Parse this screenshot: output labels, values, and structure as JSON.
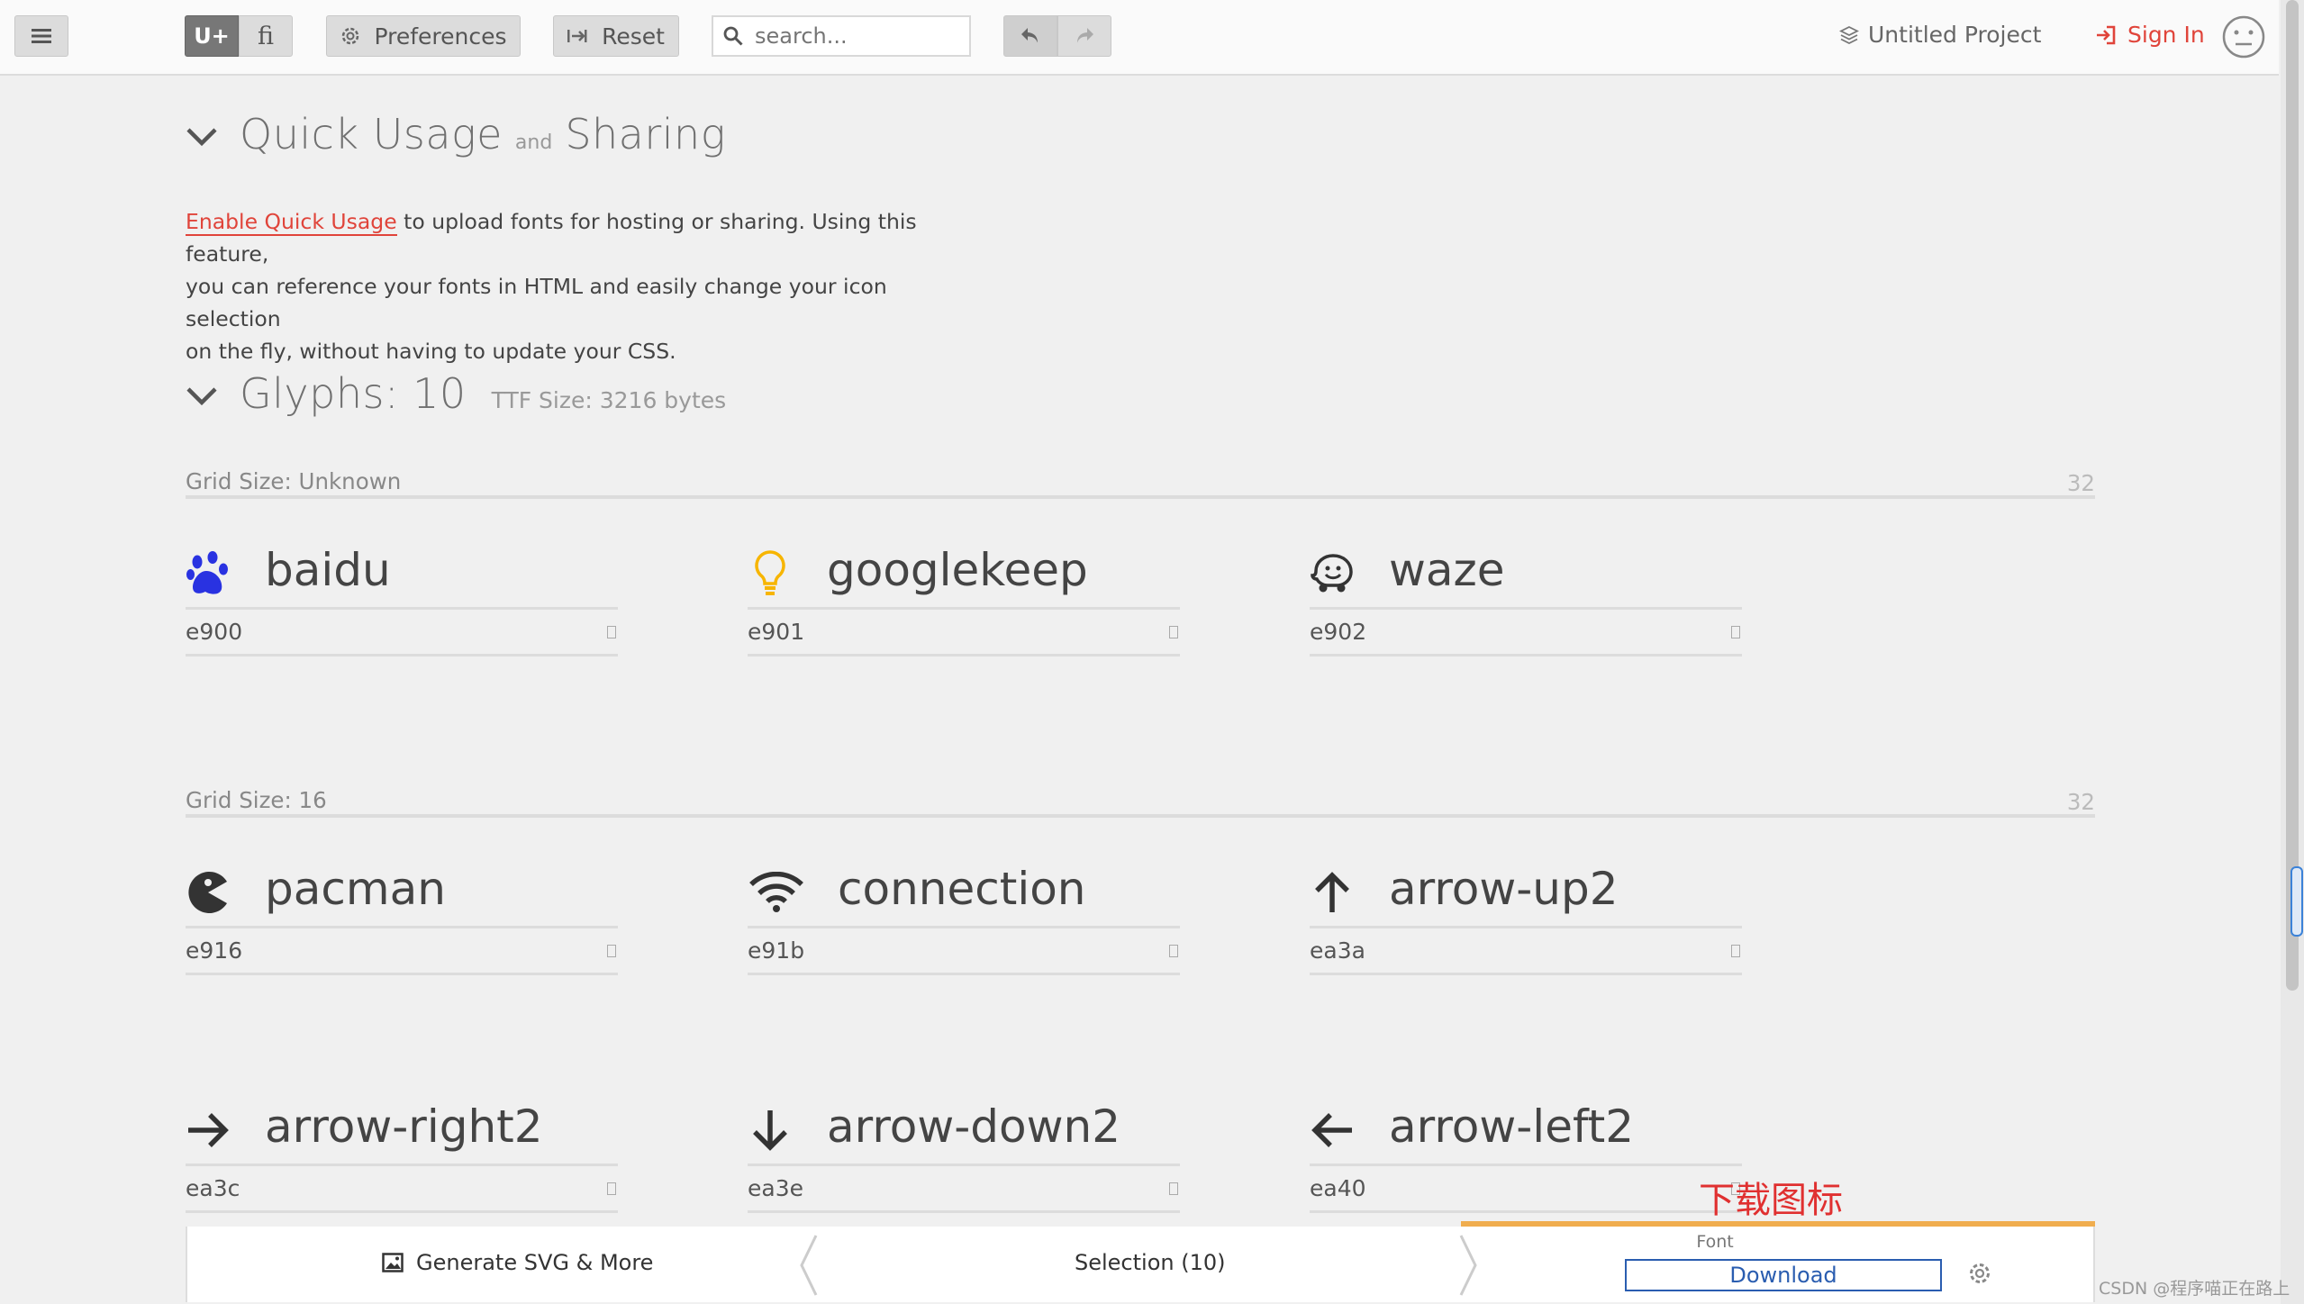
{
  "toolbar": {
    "unicode_label": "U+",
    "ligature_label": "fi",
    "preferences_label": "Preferences",
    "reset_label": "Reset",
    "search_placeholder": "search...",
    "project_label": "Untitled Project",
    "signin_label": "Sign In",
    "accent_color": "#e0443a"
  },
  "quick_usage": {
    "title_a": "Quick Usage",
    "title_and": "and",
    "title_b": "Sharing",
    "link": "Enable Quick Usage",
    "text_1": " to upload fonts for hosting or sharing. Using this feature,",
    "text_2": "you can reference your fonts in HTML and easily change your icon selection",
    "text_3": "on the fly, without having to update your CSS."
  },
  "glyphs_section": {
    "title": "Glyphs: 10",
    "ttf_size": "TTF Size: 3216 bytes"
  },
  "grids": [
    {
      "label": "Grid Size: Unknown",
      "size": "32",
      "glyphs": [
        {
          "name": "baidu",
          "code": "e900",
          "icon": "paw-icon",
          "color": "#2932e1"
        },
        {
          "name": "googlekeep",
          "code": "e901",
          "icon": "lightbulb-icon",
          "color": "#f7b500"
        },
        {
          "name": "waze",
          "code": "e902",
          "icon": "waze-icon",
          "color": "#333333"
        }
      ]
    },
    {
      "label": "Grid Size: 16",
      "size": "32",
      "glyphs": [
        {
          "name": "pacman",
          "code": "e916",
          "icon": "pacman-icon"
        },
        {
          "name": "connection",
          "code": "e91b",
          "icon": "wifi-icon"
        },
        {
          "name": "arrow-up2",
          "code": "ea3a",
          "icon": "arrow-up-icon"
        },
        {
          "name": "arrow-right2",
          "code": "ea3c",
          "icon": "arrow-right-icon"
        },
        {
          "name": "arrow-down2",
          "code": "ea3e",
          "icon": "arrow-down-icon"
        },
        {
          "name": "arrow-left2",
          "code": "ea40",
          "icon": "arrow-left-icon"
        }
      ]
    }
  ],
  "bottom_bar": {
    "generate_label": "Generate SVG & More",
    "selection_label": "Selection (10)",
    "font_label": "Font",
    "download_label": "Download",
    "tab_accent": "#f0ad4e"
  },
  "annotation": "下载图标",
  "watermark": "CSDN @程序喵正在路上"
}
